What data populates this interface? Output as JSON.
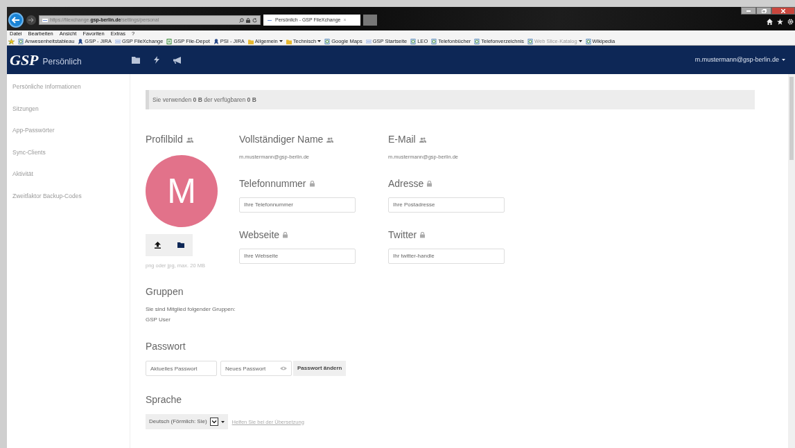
{
  "browser": {
    "url": "https://filexchange.**gsp-berlin.de**/settings/personal",
    "tab": {
      "title": "Persönlich - GSP FileXchange",
      "close": "×"
    },
    "menu": [
      "Datei",
      "Bearbeiten",
      "Ansicht",
      "Favoriten",
      "Extras",
      "?"
    ],
    "bookmarks": [
      {
        "label": "Anwesenheitstableau",
        "kind": "page",
        "dropdown": false,
        "dimmed": false
      },
      {
        "label": "GSP - JIRA",
        "kind": "jira",
        "dropdown": false,
        "dimmed": false
      },
      {
        "label": "GSP FileXchange",
        "kind": "gsp",
        "dropdown": false,
        "dimmed": false
      },
      {
        "label": "GSP File-Depot",
        "kind": "depot",
        "dropdown": false,
        "dimmed": false
      },
      {
        "label": "PSI - JIRA",
        "kind": "jira",
        "dropdown": false,
        "dimmed": false
      },
      {
        "label": "Allgemein",
        "kind": "folder",
        "dropdown": true,
        "dimmed": false
      },
      {
        "label": "Technisch",
        "kind": "folder",
        "dropdown": true,
        "dimmed": false
      },
      {
        "label": "Google Maps",
        "kind": "page",
        "dropdown": false,
        "dimmed": false
      },
      {
        "label": "GSP Startseite",
        "kind": "gsp",
        "dropdown": false,
        "dimmed": false
      },
      {
        "label": "LEO",
        "kind": "page",
        "dropdown": false,
        "dimmed": false
      },
      {
        "label": "Telefonbücher",
        "kind": "page",
        "dropdown": false,
        "dimmed": false
      },
      {
        "label": "Telefonverzeichnis",
        "kind": "page",
        "dropdown": false,
        "dimmed": false
      },
      {
        "label": "Web Slice-Katalog",
        "kind": "page",
        "dropdown": true,
        "dimmed": true
      },
      {
        "label": "Wikipedia",
        "kind": "page",
        "dropdown": false,
        "dimmed": false
      }
    ]
  },
  "app": {
    "logo": "GSP",
    "section": "Persönlich",
    "user": "m.mustermann@gsp-berlin.de"
  },
  "sidebar": {
    "items": [
      "Persönliche Informationen",
      "Sitzungen",
      "App-Passwörter",
      "Sync-Clients",
      "Aktivität",
      "Zweitfaktor Backup-Codes"
    ]
  },
  "usage": "Sie verwenden **0 B** der verfügbaren **0 B**",
  "profile": {
    "heading": "Profilbild",
    "kind": "contacts",
    "initial": "M",
    "hint": "png oder jpg, max. 20 MB"
  },
  "fields": [
    {
      "label": "Vollständiger Name",
      "kind": "contacts",
      "value": "m.mustermann@gsp-berlin.de"
    },
    {
      "label": "E-Mail",
      "kind": "contacts",
      "value": "m.mustermann@gsp-berlin.de"
    },
    {
      "label": "Telefonnummer",
      "kind": "private",
      "placeholder": "Ihre Telefonnummer"
    },
    {
      "label": "Adresse",
      "kind": "private",
      "placeholder": "Ihre Postadresse"
    },
    {
      "label": "Webseite",
      "kind": "private",
      "placeholder": "Ihre Webseite"
    },
    {
      "label": "Twitter",
      "kind": "private",
      "placeholder": "Ihr twitter-handle"
    }
  ],
  "groups": {
    "heading": "Gruppen",
    "intro": "Sie sind Mitglied folgender Gruppen:",
    "list": [
      "GSP User"
    ]
  },
  "password": {
    "heading": "Passwort",
    "current_placeholder": "Aktuelles Passwort",
    "new_placeholder": "Neues Passwort",
    "button": "Passwort ändern"
  },
  "language": {
    "heading": "Sprache",
    "value": "Deutsch (Förmlich: Sie)",
    "help_link": "Helfen Sie bei der Übersetzung"
  }
}
